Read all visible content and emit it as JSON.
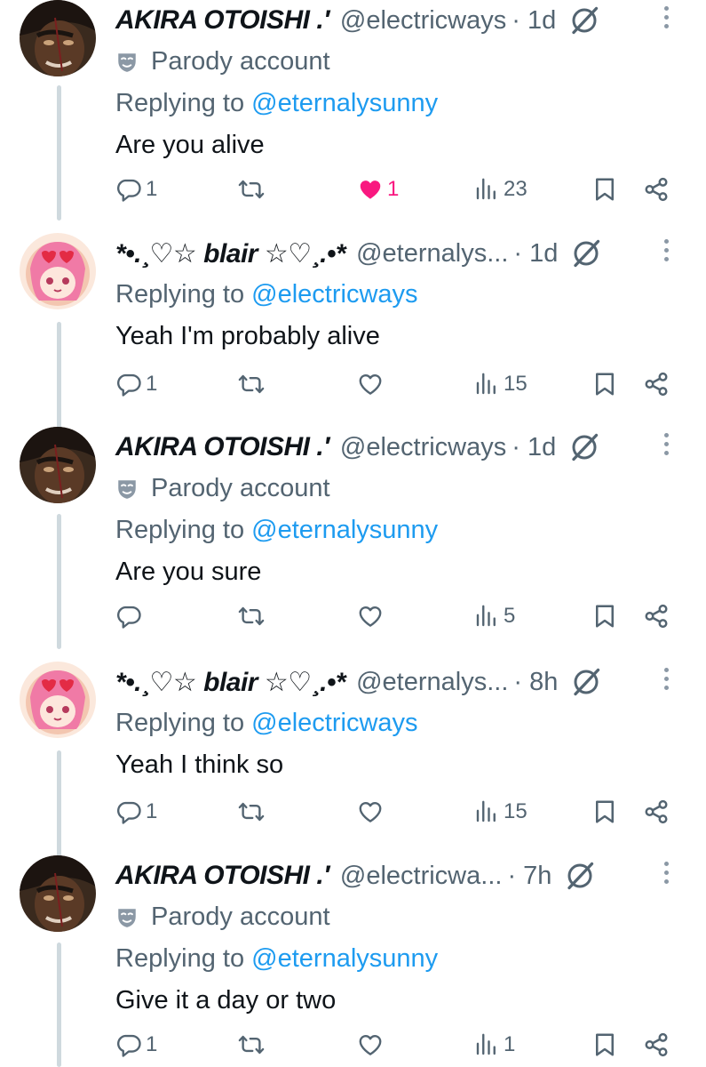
{
  "tweets": [
    {
      "author": "AKIRA OTOISHI .′",
      "handle": "@electricways",
      "time": "· 1d",
      "parody_label": "Parody account",
      "replying_prefix": "Replying to",
      "replying_to": "@eternalysunny",
      "text": "Are you alive",
      "replies": "1",
      "reposts": "",
      "likes": "1",
      "liked": true,
      "views": "23"
    },
    {
      "author": "*•.¸♡☆ blair ☆♡¸.•*",
      "handle": "@eternalys...",
      "time": "· 1d",
      "replying_prefix": "Replying to",
      "replying_to": "@electricways",
      "text": "Yeah I'm probably alive",
      "replies": "1",
      "reposts": "",
      "likes": "",
      "liked": false,
      "views": "15"
    },
    {
      "author": "AKIRA OTOISHI .′",
      "handle": "@electricways",
      "time": "· 1d",
      "parody_label": "Parody account",
      "replying_prefix": "Replying to",
      "replying_to": "@eternalysunny",
      "text": "Are you sure",
      "replies": "",
      "reposts": "",
      "likes": "",
      "liked": false,
      "views": "5"
    },
    {
      "author": "*•.¸♡☆ blair ☆♡¸.•*",
      "handle": "@eternalys...",
      "time": "· 8h",
      "replying_prefix": "Replying to",
      "replying_to": "@electricways",
      "text": "Yeah I think so",
      "replies": "1",
      "reposts": "",
      "likes": "",
      "liked": false,
      "views": "15"
    },
    {
      "author": "AKIRA OTOISHI .′",
      "handle": "@electricwa...",
      "time": "· 7h",
      "parody_label": "Parody account",
      "replying_prefix": "Replying to",
      "replying_to": "@eternalysunny",
      "text": "Give it a day or two",
      "replies": "1",
      "reposts": "",
      "likes": "",
      "liked": false,
      "views": "1"
    }
  ],
  "colors": {
    "link": "#1d9bf0",
    "muted": "#536471",
    "like_active": "#f91880",
    "thread_line": "#cfd9de"
  },
  "icons": [
    "reply-icon",
    "repost-icon",
    "like-icon",
    "views-icon",
    "bookmark-icon",
    "share-icon",
    "grok-icon",
    "more-icon",
    "parody-mask-icon"
  ]
}
